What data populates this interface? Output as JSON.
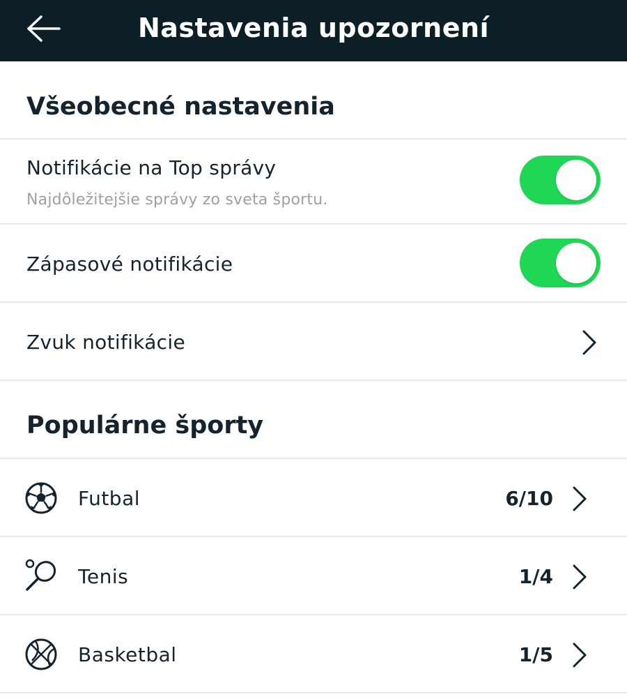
{
  "header": {
    "title": "Nastavenia upozornení",
    "back_icon": "arrow-left-icon"
  },
  "general": {
    "heading": "Všeobecné nastavenia",
    "top_news": {
      "label": "Notifikácie na Top správy",
      "subtitle": "Najdôležitejšie správy zo sveta športu.",
      "enabled": true
    },
    "match_notifications": {
      "label": "Zápasové notifikácie",
      "enabled": true
    },
    "sound": {
      "label": "Zvuk notifikácie"
    }
  },
  "popular": {
    "heading": "Populárne športy",
    "sports": [
      {
        "name": "Futbal",
        "count": "6/10",
        "icon": "soccer-ball-icon"
      },
      {
        "name": "Tenis",
        "count": "1/4",
        "icon": "tennis-racket-icon"
      },
      {
        "name": "Basketbal",
        "count": "1/5",
        "icon": "basketball-icon"
      }
    ]
  },
  "colors": {
    "header_bg": "#0c1f27",
    "toggle_on": "#1fd655",
    "text_primary": "#14232d",
    "text_secondary": "#9aa2a7",
    "divider": "#e7e9ea"
  }
}
